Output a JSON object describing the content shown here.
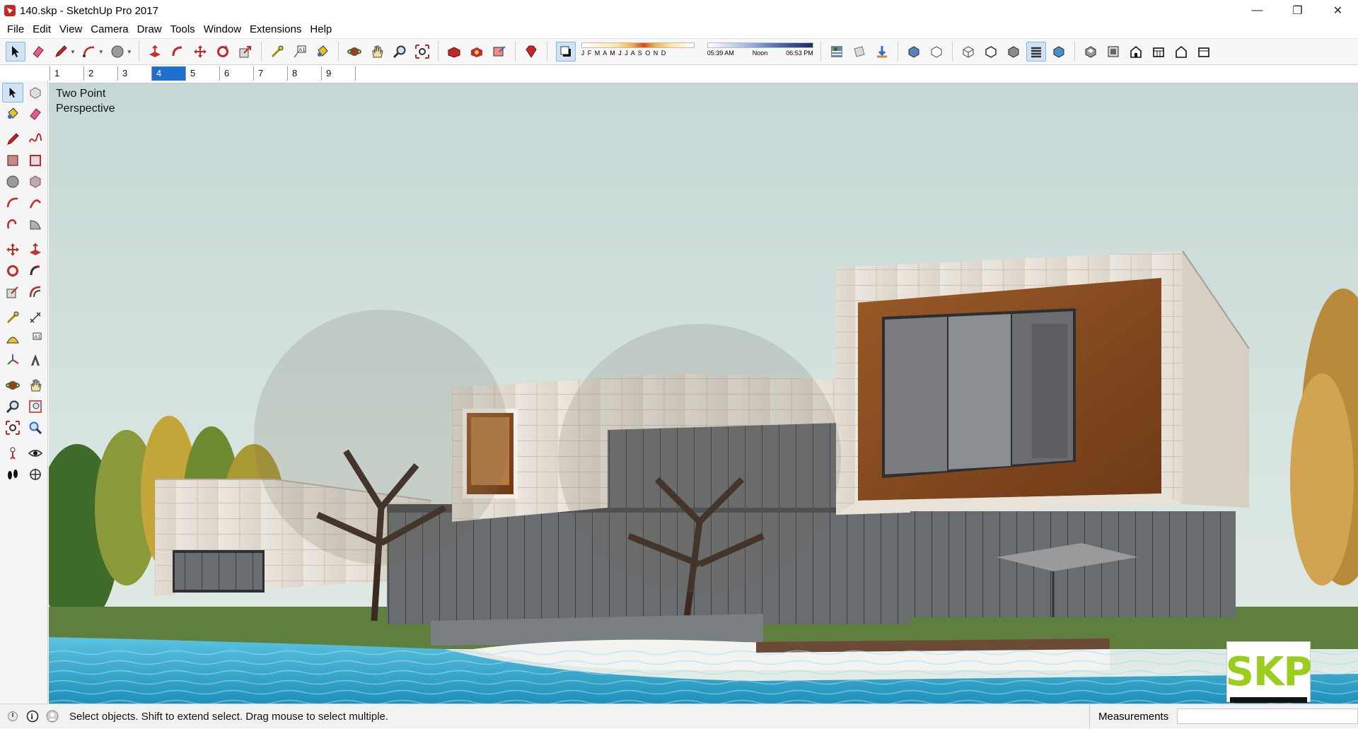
{
  "window": {
    "title": "140.skp - SketchUp Pro 2017",
    "controls": {
      "minimize": "—",
      "restore": "❐",
      "close": "✕"
    }
  },
  "menu": [
    "File",
    "Edit",
    "View",
    "Camera",
    "Draw",
    "Tools",
    "Window",
    "Extensions",
    "Help"
  ],
  "shadows": {
    "months_label": "J F M A M J J A S O N D",
    "time_start": "05:39 AM",
    "time_mid": "Noon",
    "time_end": "06:53 PM"
  },
  "scenes": {
    "tabs": [
      "1",
      "2",
      "3",
      "4",
      "5",
      "6",
      "7",
      "8",
      "9"
    ],
    "active_index": 3
  },
  "viewport": {
    "camera_label_line1": "Two Point",
    "camera_label_line2": "Perspective",
    "badge": "SKP"
  },
  "status": {
    "message": "Select objects. Shift to extend select. Drag mouse to select multiple.",
    "measurements_label": "Measurements",
    "measurements_value": ""
  },
  "colors": {
    "accent": "#1f6fd1",
    "sky_top": "#d4e2e2",
    "water": "#2fa6cc",
    "badge_green": "#9acd1d",
    "wood": "#8a4a1e"
  },
  "icons": {
    "top_toolbar": [
      "select-icon",
      "eraser-icon",
      "pencil-icon",
      "arc-icon",
      "circle-icon",
      "push-pull-icon",
      "follow-me-icon",
      "move-icon",
      "rotate-icon",
      "scale-icon",
      "tape-measure-icon",
      "text-icon",
      "paint-bucket-icon",
      "orbit-icon",
      "pan-icon",
      "zoom-icon",
      "zoom-extents-icon",
      "warehouse-icon",
      "extension-warehouse-icon",
      "share-model-icon",
      "ruby-icon",
      "shadows-toggle-icon",
      "fog-icon",
      "section-plane-icon",
      "section-display-icon",
      "xray-icon",
      "back-edges-icon",
      "wireframe-icon",
      "hidden-line-icon",
      "shaded-icon",
      "textured-icon",
      "monochrome-icon",
      "iso-view-icon",
      "top-view-icon",
      "front-view-icon",
      "right-view-icon",
      "back-view-icon",
      "left-view-icon"
    ]
  }
}
